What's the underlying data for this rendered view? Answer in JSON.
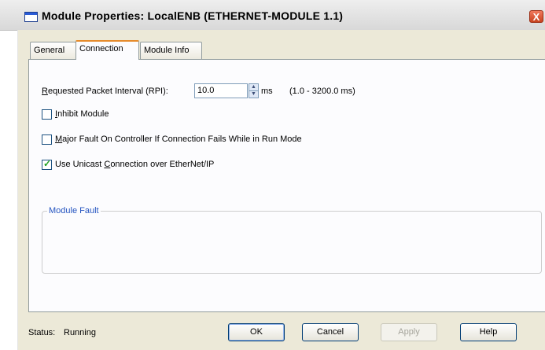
{
  "window": {
    "title": "Module Properties: LocalENB (ETHERNET-MODULE 1.1)",
    "close_glyph": "X"
  },
  "tabs": [
    {
      "label": "General"
    },
    {
      "label": "Connection",
      "active": true
    },
    {
      "label": "Module Info"
    }
  ],
  "connection": {
    "rpi_label_prefix": "",
    "rpi_label_mnemonic": "R",
    "rpi_label_rest": "equested Packet Interval (RPI):",
    "rpi_value": "10.0",
    "rpi_unit": "ms",
    "rpi_range": "(1.0 - 3200.0 ms)",
    "inhibit": {
      "mnemonic": "I",
      "rest": "nhibit Module",
      "checked": false
    },
    "major_fault": {
      "mnemonic": "M",
      "rest": "ajor Fault On Controller If Connection Fails While in Run Mode",
      "checked": false
    },
    "unicast": {
      "prefix": "Use Unicast ",
      "mnemonic": "C",
      "rest": "onnection over EtherNet/IP",
      "checked": true
    }
  },
  "module_fault": {
    "title": "Module Fault"
  },
  "footer": {
    "status_label": "Status:",
    "status_value": "Running",
    "ok": "OK",
    "cancel": "Cancel",
    "apply": "Apply",
    "help": "Help"
  },
  "colors": {
    "accent_tab": "#e68b2c",
    "group_title": "#2454c0",
    "check": "#21a121"
  }
}
